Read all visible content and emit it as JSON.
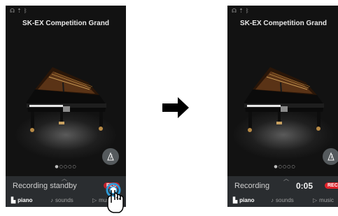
{
  "colors": {
    "screen_bg": "#121212",
    "panel_bg": "#2a2d30",
    "rec_red": "#e0232b",
    "touch_highlight": "#2f9bd8"
  },
  "left_screen": {
    "status_icons": [
      "headphones-icon",
      "usb-icon",
      "bluetooth-icon"
    ],
    "title": "SK-EX Competition Grand",
    "page_dots": "●○○○○",
    "panel": {
      "status_text": "Recording standby",
      "rec_label": "REC"
    },
    "nav": {
      "piano": "piano",
      "sounds": "sounds",
      "music": "music"
    }
  },
  "right_screen": {
    "status_icons": [
      "headphones-icon",
      "usb-icon",
      "bluetooth-icon"
    ],
    "title": "SK-EX Competition Grand",
    "page_dots": "●○○○○",
    "panel": {
      "status_text": "Recording",
      "timer": "0:05",
      "rec_label": "REC"
    },
    "nav": {
      "piano": "piano",
      "sounds": "sounds",
      "music": "music"
    }
  },
  "transition_icon": "right-arrow-icon",
  "gesture_icon": "tap-hand-icon"
}
